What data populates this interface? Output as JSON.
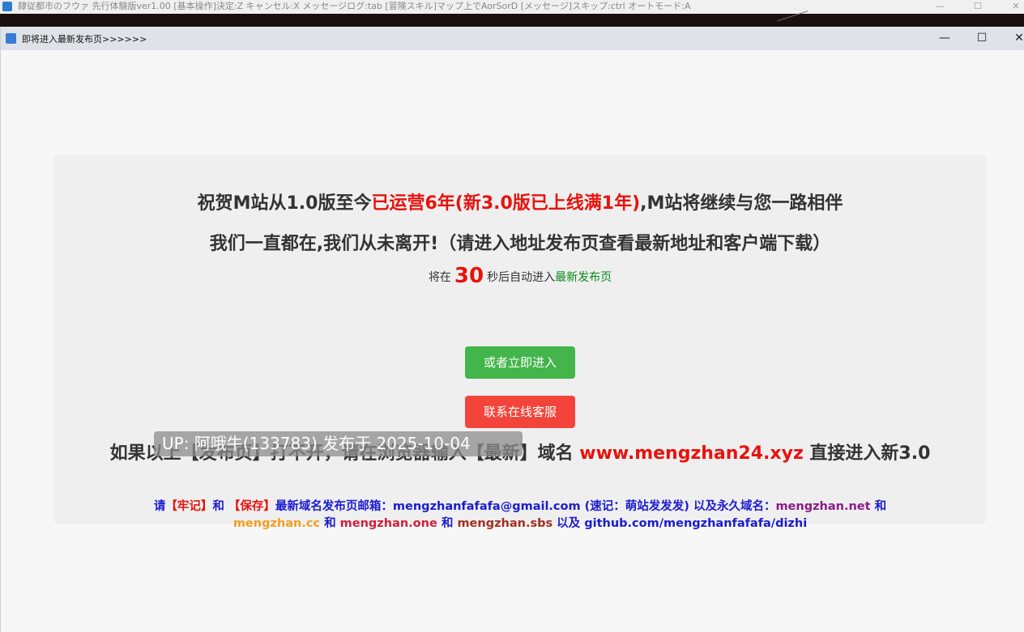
{
  "bg_window": {
    "title": "隷従都市のフウァ 先行体験版ver1.00 [基本操作]決定:Z キャンセル:X メッセージログ:tab [冒険スキル]マップ上でAorSorD [メッセージ]スキップ:ctrl オートモード:A",
    "controls": [
      "—",
      "☐",
      "✕"
    ]
  },
  "window": {
    "title": "即将进入最新发布页>>>>>>",
    "controls": [
      "—",
      "☐",
      "✕"
    ]
  },
  "content": {
    "line1_pre": "祝贺M站从1.0版至今",
    "line1_red": "已运营6年(新3.0版已上线满1年)",
    "line1_post": ",M站将继续与您一路相伴",
    "line2": "我们一直都在,我们从未离开!（请进入地址发布页查看最新地址和客户端下载）",
    "countdown_pre": "将在",
    "countdown_num": "30",
    "countdown_mid": "秒后自动进入",
    "countdown_link": "最新发布页",
    "btn_enter": "或者立即进入",
    "btn_service": "联系在线客服",
    "domain_pre": "如果以上【发布页】打不开，请在浏览器输入【最新】域名",
    "domain_url": "www.mengzhan24.xyz",
    "domain_post": "直接进入新3.0",
    "mail": {
      "p1": "请",
      "p2": "【牢记】",
      "p3": "和",
      "p4": "【保存】",
      "p5": "最新域名发布页邮箱：mengzhanfafafa@gmail.com (速记：萌站发发发) 以及永久域名：",
      "p6": "mengzhan.net",
      "p7": "和",
      "p8": "mengzhan.cc",
      "p9": "和",
      "p10": "mengzhan.one",
      "p11": "和",
      "p12": "mengzhan.sbs",
      "p13": "以及 github.com/mengzhanfafafa/dizhi"
    }
  },
  "watermark": "UP: 阿哦牛(133783) 发布于 2025-10-04"
}
